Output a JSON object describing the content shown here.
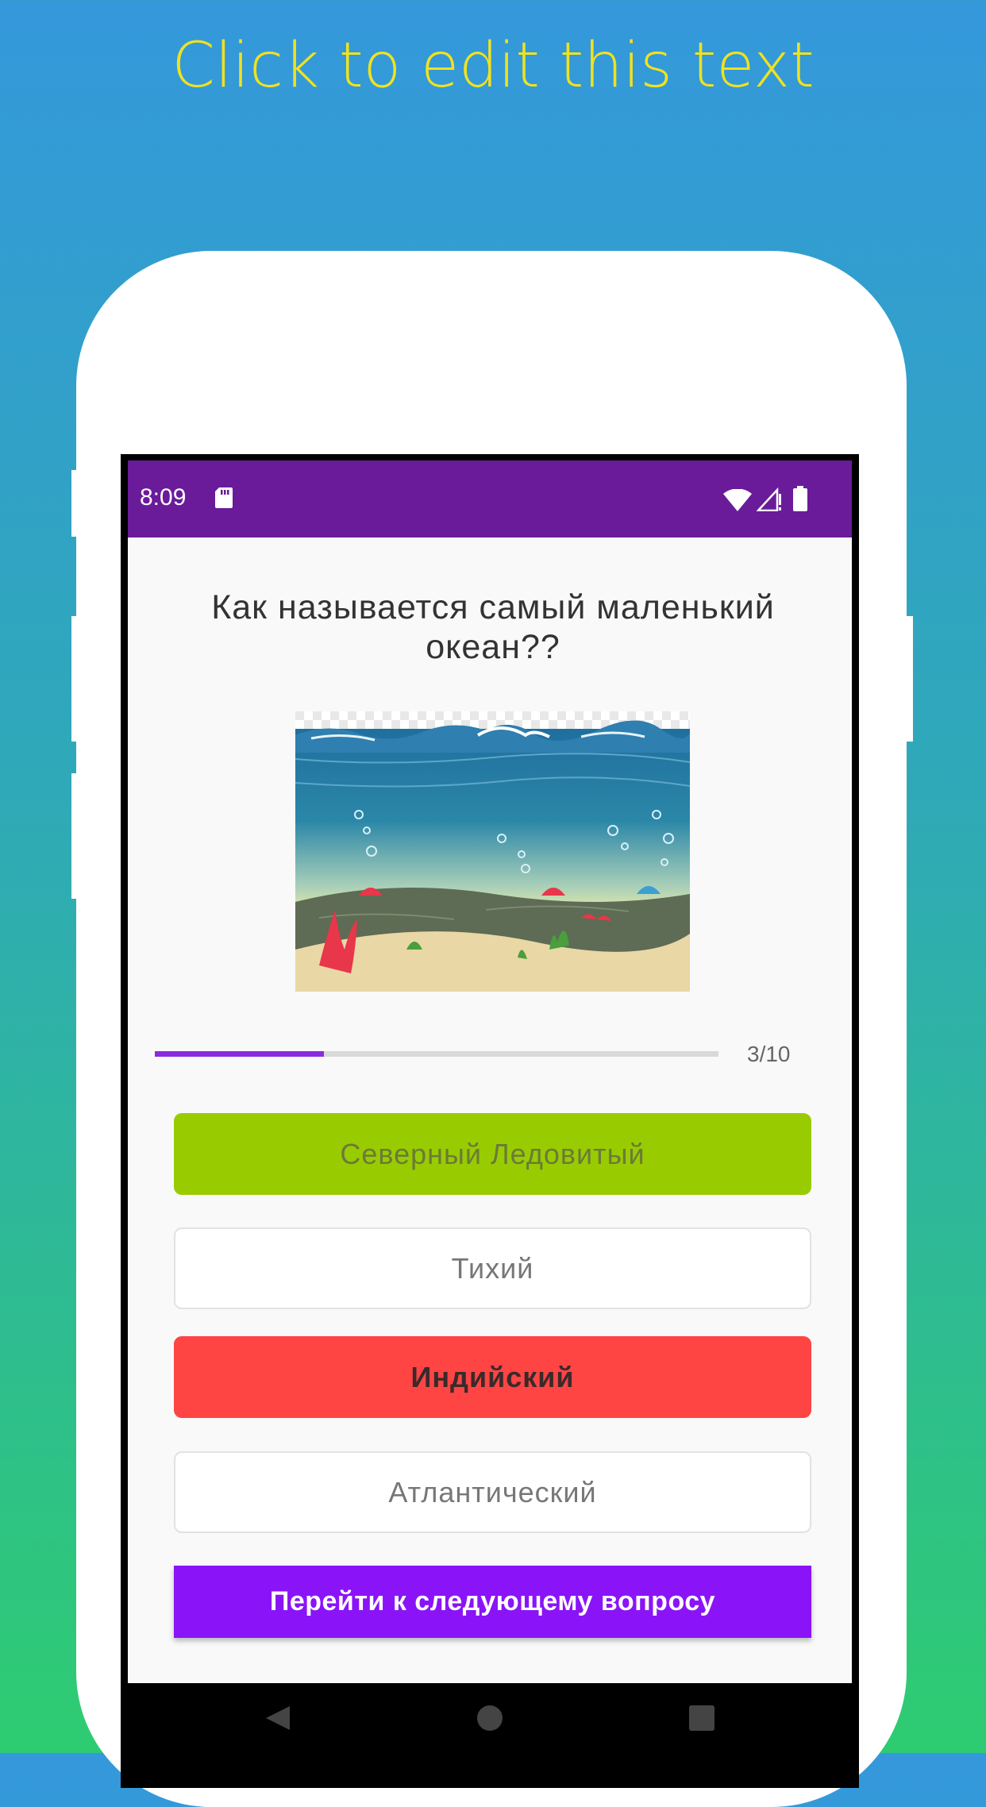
{
  "promo": {
    "title": "Click to edit this text"
  },
  "status_bar": {
    "time": "8:09",
    "bg_color": "#6a1b9a",
    "icons": [
      "sd-card-icon",
      "wifi-icon",
      "signal-icon",
      "battery-icon"
    ]
  },
  "quiz": {
    "question": "Как называется самый маленький океан??",
    "image": "underwater-ocean-illustration",
    "progress": {
      "label": "3/10",
      "fraction": 0.3
    },
    "answers": [
      {
        "label": "Северный Ледовитый",
        "state": "correct",
        "color": "#99cc00"
      },
      {
        "label": "Тихий",
        "state": "neutral",
        "color": "#ffffff"
      },
      {
        "label": "Индийский",
        "state": "wrong",
        "color": "#ff4444"
      },
      {
        "label": "Атлантический",
        "state": "neutral",
        "color": "#ffffff"
      }
    ],
    "next_button": {
      "label": "Перейти к следующему вопросу",
      "color": "#8a14f7"
    }
  },
  "nav_bar": {
    "icons": [
      "back-icon",
      "home-icon",
      "recents-icon"
    ]
  }
}
